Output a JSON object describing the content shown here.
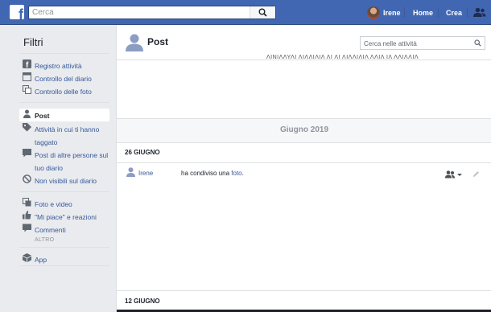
{
  "topbar": {
    "search_placeholder": "Cerca",
    "user_name": "Irene",
    "home_label": "Home",
    "create_label": "Crea"
  },
  "filters": {
    "title": "Filtri",
    "items": [
      {
        "label": "Registro attività",
        "icon": "registry-icon"
      },
      {
        "label": "Controllo del diario",
        "icon": "timeline-review-icon"
      },
      {
        "label": "Controllo delle foto",
        "icon": "photo-review-icon"
      },
      {
        "label": "Post",
        "icon": "person-icon",
        "active": true
      },
      {
        "label": "Attività in cui ti hanno taggato",
        "icon": "tag-icon"
      },
      {
        "label": "Post di altre persone sul tuo diario",
        "icon": "post-icon"
      },
      {
        "label": "Non visibili sul diario",
        "icon": "hidden-icon"
      },
      {
        "label": "Foto e video",
        "icon": "photos-icon"
      },
      {
        "label": "\"Mi piace\" e reazioni",
        "icon": "like-icon"
      },
      {
        "label": "Commenti",
        "icon": "comment-icon"
      },
      {
        "label": "App",
        "icon": "app-icon"
      }
    ],
    "more_label": "ALTRO"
  },
  "main": {
    "title": "Post",
    "search_placeholder": "Cerca nelle attività",
    "cut_off_text": "ΛΙΝΙΛΛΥΛΙ ΛΙΛΛΙΛΙΛ ΛΙ ΛΙ ΛΙΛΛΙΛΙΛ ΛΛΙΛ ΙΛ ΛΛΙΛΛΙΛ",
    "month": "Giugno 2019",
    "groups": [
      {
        "date": "26 GIUGNO",
        "activity": {
          "user": "Irene",
          "action": "ha condiviso una",
          "object": "foto",
          "end": "."
        }
      },
      {
        "date": "12 GIUGNO"
      }
    ]
  },
  "colors": {
    "brand": "#4267b2",
    "link": "#365899",
    "background": "#e9ebee"
  }
}
